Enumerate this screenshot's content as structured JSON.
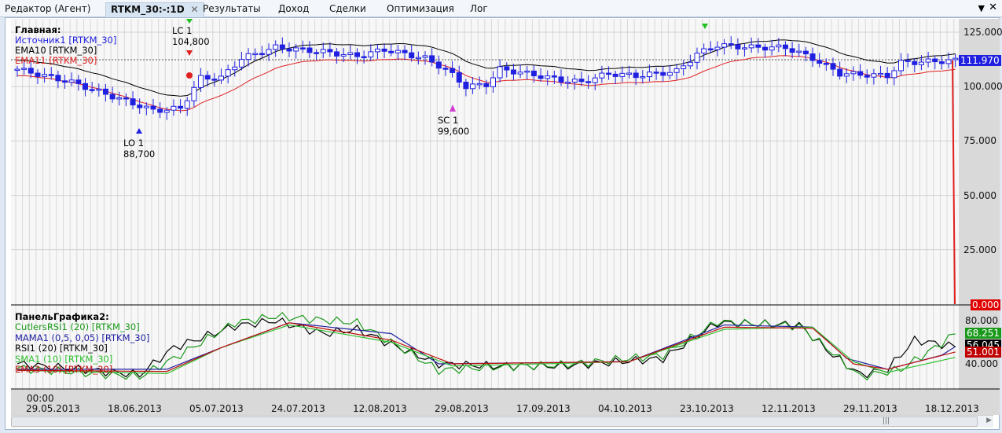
{
  "tabs": [
    {
      "label": "Редактор (Агент)"
    },
    {
      "label": "RTKM_30:-:1D",
      "active": true
    },
    {
      "label": "Результаты"
    },
    {
      "label": "Доход"
    },
    {
      "label": "Сделки"
    },
    {
      "label": "Оптимизация"
    },
    {
      "label": "Лог"
    }
  ],
  "main_panel": {
    "title": "Главная:",
    "legend": [
      {
        "text": "Источник1 [RTKM_30]",
        "color": "#2020e0"
      },
      {
        "text": "EMA10 [RTKM_30]",
        "color": "#000000"
      },
      {
        "text": "EMA11 [RTKM_30]",
        "color": "#e02020"
      }
    ],
    "y_ticks": [
      "125.000",
      "100.000",
      "75.000",
      "50.000",
      "25.000"
    ],
    "last_price": "111.970",
    "zero_price": "0.000",
    "markers": [
      {
        "label": "LC 1",
        "value": "104,800"
      },
      {
        "label": "LO 1",
        "value": "88,700"
      },
      {
        "label": "SC 1",
        "value": "99,600"
      }
    ]
  },
  "sub_panel": {
    "title": "ПанельГрафика2:",
    "legend": [
      {
        "text": "CutlersRSI1 (20) [RTKM_30]",
        "color": "#1a9a1a"
      },
      {
        "text": "MAMA1 (0,5, 0,05) [RTKM_30]",
        "color": "#2020a0"
      },
      {
        "text": "RSI1 (20) [RTKM_30]",
        "color": "#000000"
      },
      {
        "text": "SMA1 (10) [RTKM_30]",
        "color": "#30c030"
      },
      {
        "text": "EMA3 (10) [RTKM_30]",
        "color": "#c01010"
      }
    ],
    "y_ticks": [
      "80.000",
      "40.000"
    ],
    "badges": [
      {
        "text": "68.251",
        "color": "#1a9a1a"
      },
      {
        "text": "56.045",
        "color": "#000000"
      },
      {
        "text": "51.001",
        "color": "#c00000"
      }
    ]
  },
  "x_axis": {
    "time": "00:00",
    "dates": [
      "29.05.2013",
      "18.06.2013",
      "05.07.2013",
      "24.07.2013",
      "12.08.2013",
      "29.08.2013",
      "17.09.2013",
      "04.10.2013",
      "23.10.2013",
      "12.11.2013",
      "29.11.2013",
      "18.12.2013"
    ]
  },
  "chart_data": {
    "type": "candlestick",
    "price_keypoints": [
      [
        0,
        108
      ],
      [
        8,
        102
      ],
      [
        20,
        89
      ],
      [
        24,
        90
      ],
      [
        27,
        104
      ],
      [
        30,
        104
      ],
      [
        33,
        113
      ],
      [
        38,
        118
      ],
      [
        45,
        116
      ],
      [
        50,
        114
      ],
      [
        54,
        117
      ],
      [
        60,
        113
      ],
      [
        63,
        108
      ],
      [
        66,
        100
      ],
      [
        69,
        101
      ],
      [
        71,
        108
      ],
      [
        75,
        106
      ],
      [
        80,
        103
      ],
      [
        83,
        102
      ],
      [
        87,
        106
      ],
      [
        91,
        105
      ],
      [
        97,
        107
      ],
      [
        100,
        115
      ],
      [
        103,
        119
      ],
      [
        108,
        118
      ],
      [
        113,
        118
      ],
      [
        117,
        113
      ],
      [
        121,
        106
      ],
      [
        128,
        105
      ],
      [
        130,
        111
      ],
      [
        138,
        112
      ]
    ],
    "sub_keypoints": {
      "rsi": [
        [
          0,
          40
        ],
        [
          18,
          30
        ],
        [
          23,
          55
        ],
        [
          32,
          75
        ],
        [
          38,
          80
        ],
        [
          45,
          68
        ],
        [
          50,
          72
        ],
        [
          55,
          58
        ],
        [
          62,
          40
        ],
        [
          70,
          38
        ],
        [
          80,
          38
        ],
        [
          95,
          45
        ],
        [
          103,
          78
        ],
        [
          115,
          76
        ],
        [
          120,
          48
        ],
        [
          124,
          30
        ],
        [
          128,
          35
        ],
        [
          132,
          62
        ],
        [
          138,
          56
        ]
      ],
      "cutlers": [
        [
          0,
          36
        ],
        [
          18,
          28
        ],
        [
          23,
          45
        ],
        [
          32,
          78
        ],
        [
          38,
          84
        ],
        [
          50,
          78
        ],
        [
          55,
          60
        ],
        [
          62,
          34
        ],
        [
          70,
          37
        ],
        [
          80,
          39
        ],
        [
          95,
          48
        ],
        [
          103,
          79
        ],
        [
          115,
          75
        ],
        [
          120,
          50
        ],
        [
          124,
          28
        ],
        [
          130,
          35
        ],
        [
          135,
          55
        ],
        [
          138,
          68
        ]
      ],
      "mama": [
        [
          0,
          35
        ],
        [
          22,
          35
        ],
        [
          30,
          55
        ],
        [
          40,
          78
        ],
        [
          55,
          68
        ],
        [
          62,
          40
        ],
        [
          90,
          42
        ],
        [
          104,
          76
        ],
        [
          117,
          74
        ],
        [
          122,
          45
        ],
        [
          128,
          35
        ],
        [
          136,
          48
        ],
        [
          138,
          56
        ]
      ],
      "sma": [
        [
          0,
          34
        ],
        [
          22,
          31
        ],
        [
          30,
          55
        ],
        [
          40,
          76
        ],
        [
          55,
          60
        ],
        [
          64,
          38
        ],
        [
          90,
          42
        ],
        [
          104,
          72
        ],
        [
          117,
          74
        ],
        [
          123,
          42
        ],
        [
          128,
          32
        ],
        [
          138,
          46
        ]
      ],
      "ema": [
        [
          0,
          34
        ],
        [
          22,
          33
        ],
        [
          30,
          55
        ],
        [
          40,
          78
        ],
        [
          55,
          62
        ],
        [
          64,
          40
        ],
        [
          90,
          42
        ],
        [
          104,
          74
        ],
        [
          117,
          73
        ],
        [
          123,
          40
        ],
        [
          128,
          35
        ],
        [
          138,
          51
        ]
      ]
    }
  }
}
